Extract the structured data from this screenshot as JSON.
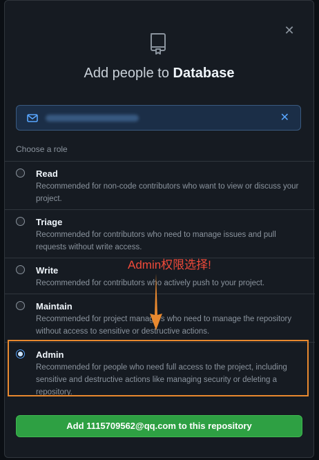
{
  "dialog": {
    "title_prefix": "Add people to ",
    "repo_name": "Database",
    "close_icon": "close-icon"
  },
  "invitee": {
    "email": "",
    "email_redacted": true
  },
  "roles_heading": "Choose a role",
  "roles": [
    {
      "name": "Read",
      "description": "Recommended for non-code contributors who want to view or discuss your project.",
      "selected": false
    },
    {
      "name": "Triage",
      "description": "Recommended for contributors who need to manage issues and pull requests without write access.",
      "selected": false
    },
    {
      "name": "Write",
      "description": "Recommended for contributors who actively push to your project.",
      "selected": false
    },
    {
      "name": "Maintain",
      "description": "Recommended for project managers who need to manage the repository without access to sensitive or destructive actions.",
      "selected": false
    },
    {
      "name": "Admin",
      "description": "Recommended for people who need full access to the project, including sensitive and destructive actions like managing security or deleting a repository.",
      "selected": true
    }
  ],
  "annotation": "Admin权限选择!",
  "submit_label": "Add 1115709562@qq.com to this repository",
  "colors": {
    "accent": "#58a6ff",
    "primary_button": "#2ea043",
    "highlight_box": "#e9892f",
    "annotation_text": "#f04a3a"
  }
}
